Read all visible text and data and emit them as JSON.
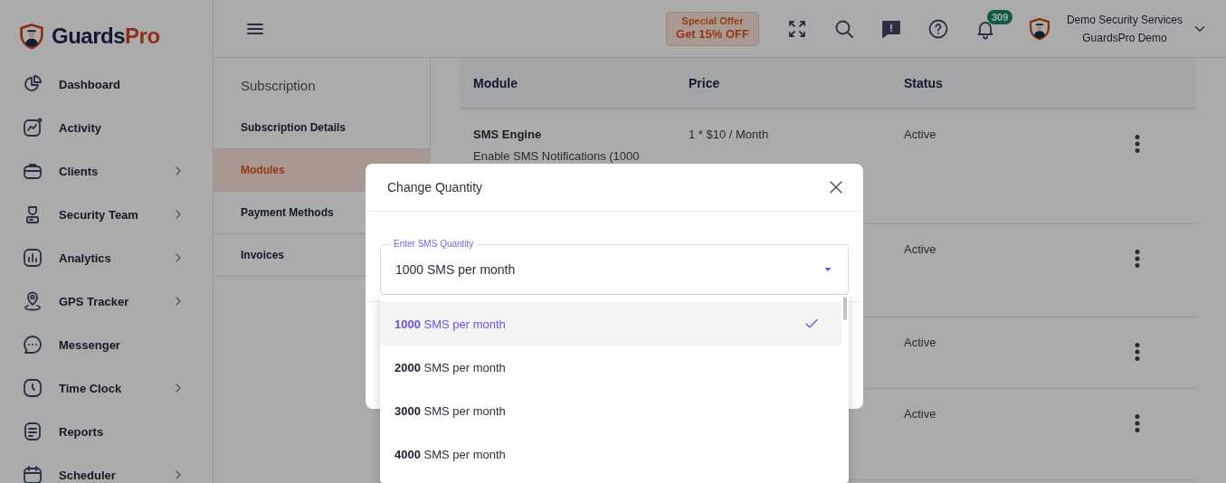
{
  "logo": {
    "name": "Guards",
    "accent": "Pro"
  },
  "sidebar": {
    "items": [
      {
        "label": "Dashboard",
        "expandable": false
      },
      {
        "label": "Activity",
        "expandable": false
      },
      {
        "label": "Clients",
        "expandable": true
      },
      {
        "label": "Security Team",
        "expandable": true
      },
      {
        "label": "Analytics",
        "expandable": true
      },
      {
        "label": "GPS Tracker",
        "expandable": true
      },
      {
        "label": "Messenger",
        "expandable": false
      },
      {
        "label": "Time Clock",
        "expandable": true
      },
      {
        "label": "Reports",
        "expandable": false
      },
      {
        "label": "Scheduler",
        "expandable": true
      }
    ]
  },
  "header": {
    "offer": {
      "title": "Special Offer",
      "text": "Get 15% OFF"
    },
    "notifications": "309",
    "user": {
      "name": "Demo Security Services",
      "company": "GuardsPro Demo"
    }
  },
  "subnav": {
    "title": "Subscription",
    "items": [
      {
        "label": "Subscription Details",
        "selected": false
      },
      {
        "label": "Modules",
        "selected": true
      },
      {
        "label": "Payment Methods",
        "selected": false
      },
      {
        "label": "Invoices",
        "selected": false
      }
    ]
  },
  "table": {
    "columns": [
      "Module",
      "Price",
      "Status"
    ],
    "rows": [
      {
        "module": "SMS Engine",
        "description": "Enable SMS Notifications (1000",
        "price": "1 * $10 / Month",
        "status": "Active"
      },
      {
        "status": "Active"
      },
      {
        "status": "Active"
      },
      {
        "status": "Active"
      }
    ]
  },
  "modal": {
    "title": "Change Quantity",
    "field": {
      "label": "Enter SMS Quantity",
      "value": "1000 SMS per month"
    },
    "options": [
      {
        "label": "**1000** SMS per month",
        "selected": true
      },
      {
        "label": "**2000** SMS per month",
        "selected": false
      },
      {
        "label": "**3000** SMS per month",
        "selected": false
      },
      {
        "label": "**4000** SMS per month",
        "selected": false
      }
    ]
  }
}
